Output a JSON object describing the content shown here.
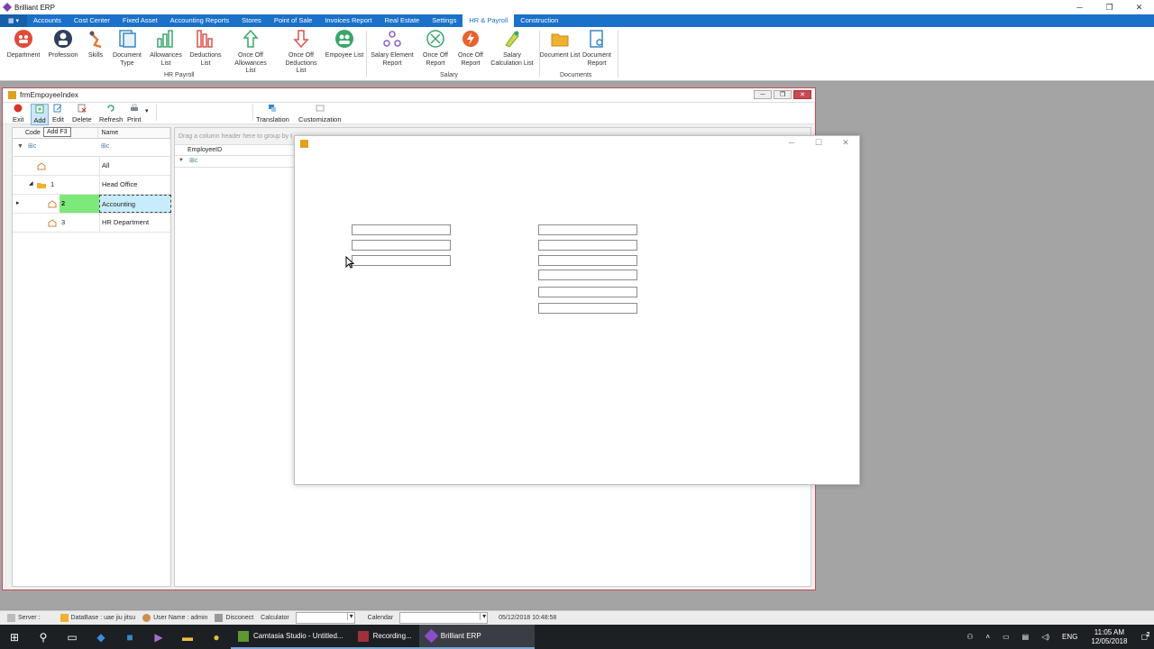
{
  "app": {
    "title": "Brilliant ERP"
  },
  "ribbon_tabs": [
    {
      "label": "Accounts"
    },
    {
      "label": "Cost Center"
    },
    {
      "label": "Fixed Asset"
    },
    {
      "label": "Accounting Reports"
    },
    {
      "label": "Stores"
    },
    {
      "label": "Point of Sale"
    },
    {
      "label": "Invoices Report"
    },
    {
      "label": "Real Estate"
    },
    {
      "label": "Settings"
    },
    {
      "label": "HR & Payroll",
      "active": true
    },
    {
      "label": "Construction"
    }
  ],
  "ribbon": {
    "buttons": [
      {
        "label": "Department",
        "icon": "department-icon"
      },
      {
        "label": "Profession",
        "icon": "profession-icon"
      },
      {
        "label": "Skills",
        "icon": "skills-icon"
      },
      {
        "label": "Document Type",
        "icon": "document-type-icon"
      },
      {
        "label": "Allowances List",
        "icon": "allowances-icon"
      },
      {
        "label": "Deductions List",
        "icon": "deductions-icon"
      },
      {
        "label": "Once Off Allowances List",
        "icon": "up-arrow-icon"
      },
      {
        "label": "Once Off Deductions List",
        "icon": "down-arrow-icon"
      },
      {
        "label": "Empoyee List",
        "icon": "employee-icon"
      },
      {
        "label": "Salary Element Report",
        "icon": "salary-element-icon"
      },
      {
        "label": "Once Off Report",
        "icon": "once-off-report-icon"
      },
      {
        "label": "Once Off Report",
        "icon": "once-off-report-red-icon"
      },
      {
        "label": "Salary Calculation List",
        "icon": "salary-calc-icon"
      },
      {
        "label": "Document List",
        "icon": "folder-icon"
      },
      {
        "label": "Document Report",
        "icon": "document-report-icon"
      }
    ],
    "groups": {
      "hr_payroll": "HR  Payroll",
      "salary": "Salary",
      "documents": "Documents"
    }
  },
  "child_window": {
    "title": "frmEmpoyeeIndex",
    "toolbar": {
      "exit": "Exit",
      "add": "Add",
      "edit": "Edit",
      "delete": "Delete",
      "refresh": "Refresh",
      "print": "Print",
      "translation": "Translation",
      "customization": "Customization"
    },
    "tooltip": "Add F3",
    "tree": {
      "headers": {
        "code": "Code",
        "name": "Name"
      },
      "rows": [
        {
          "code": "",
          "name": "All"
        },
        {
          "code": "1",
          "name": "Head Office"
        },
        {
          "code": "2",
          "name": "Accounting"
        },
        {
          "code": "3",
          "name": "HR Department"
        }
      ]
    },
    "grid": {
      "group_hint": "Drag a column header here to group by t",
      "column": "EmployeeID"
    }
  },
  "statusbar": {
    "server": "Server :",
    "database": "DataBase : uae jiu jitsu",
    "user": "User Name : admin",
    "disconnect": "Disconect",
    "calculator": "Calculator",
    "calendar": "Calendar",
    "datetime": "05/12/2018 10:48:58"
  },
  "taskbar": {
    "tasks": [
      {
        "label": "Camtasia Studio - Untitled..."
      },
      {
        "label": "Recording..."
      },
      {
        "label": "Brilliant ERP"
      }
    ],
    "lang": "ENG",
    "time": "11:05 AM",
    "date": "12/05/2018",
    "notif_count": "2"
  },
  "colors": {
    "ribbon_blue": "#1a71c9",
    "selected_code": "#7ee87a",
    "selected_name": "#c7ecfb"
  }
}
